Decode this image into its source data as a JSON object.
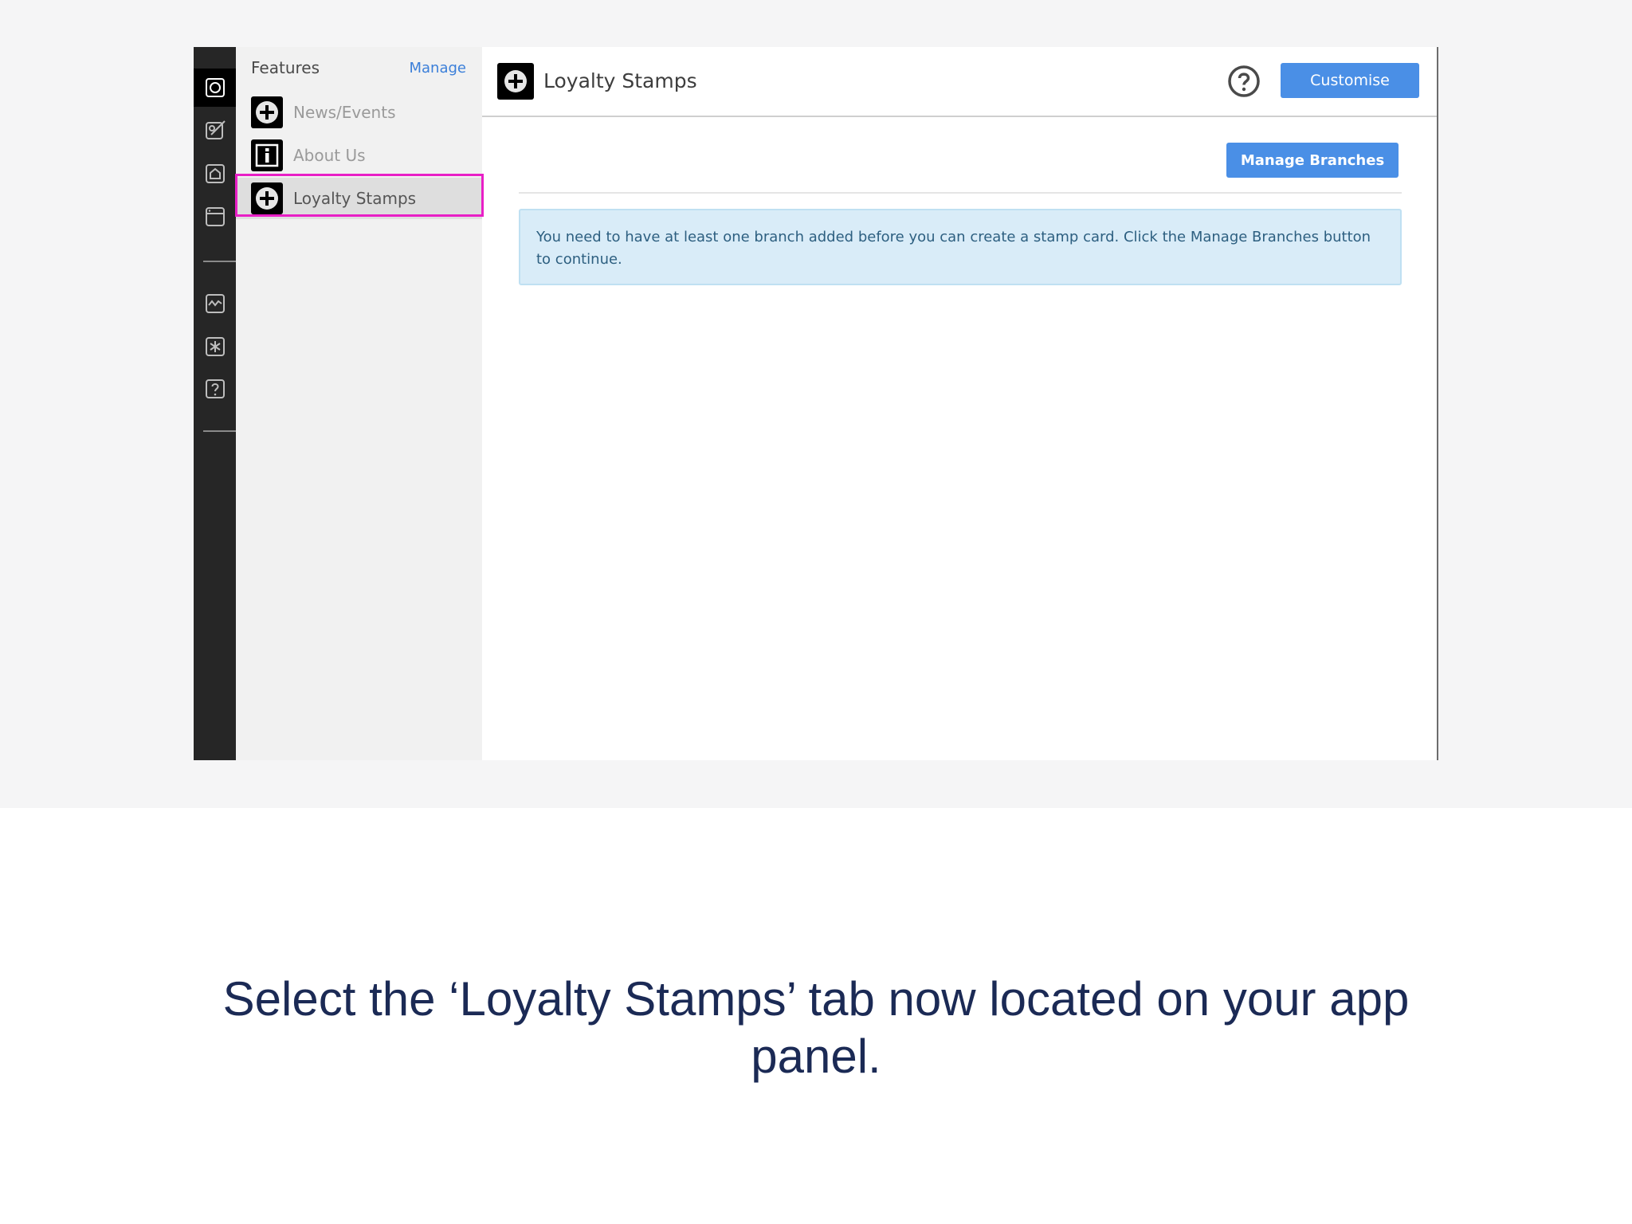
{
  "features_panel": {
    "title": "Features",
    "manage_label": "Manage",
    "items": [
      {
        "label": "News/Events",
        "icon": "plus-circle-icon"
      },
      {
        "label": "About Us",
        "icon": "info-icon"
      },
      {
        "label": "Loyalty Stamps",
        "icon": "plus-circle-icon",
        "selected": true
      }
    ]
  },
  "main": {
    "title": "Loyalty Stamps",
    "customise_label": "Customise",
    "manage_branches_label": "Manage Branches",
    "alert_text": "You need to have at least one branch added before you can create a stamp card. Click the Manage Branches button to continue."
  },
  "caption": "Select the ‘Loyalty Stamps’ tab now located on your app panel.",
  "colors": {
    "accent_blue": "#4a8fe6",
    "highlight_magenta": "#e81fc6",
    "alert_bg": "#d9ecf8",
    "caption_navy": "#1b2a55"
  }
}
